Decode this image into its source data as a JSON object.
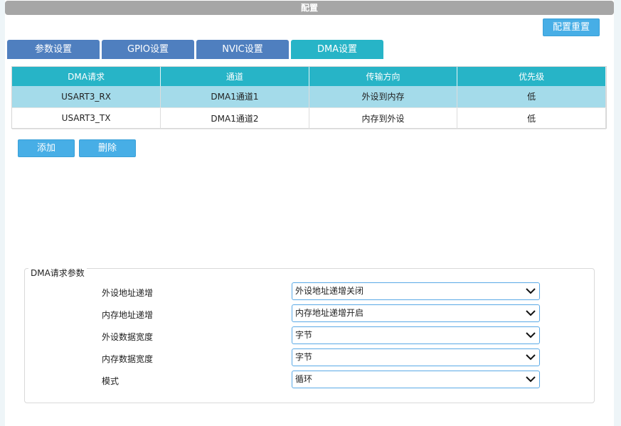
{
  "title": "配置",
  "reset_button": "配置重置",
  "tabs": [
    {
      "label": "参数设置"
    },
    {
      "label": "GPIO设置"
    },
    {
      "label": "NVIC设置"
    },
    {
      "label": "DMA设置"
    }
  ],
  "table": {
    "headers": [
      "DMA请求",
      "通道",
      "传输方向",
      "优先级"
    ],
    "rows": [
      [
        "USART3_RX",
        "DMA1通道1",
        "外设到内存",
        "低"
      ],
      [
        "USART3_TX",
        "DMA1通道2",
        "内存到外设",
        "低"
      ]
    ]
  },
  "actions": {
    "add": "添加",
    "delete": "删除"
  },
  "params": {
    "legend": "DMA请求参数",
    "fields": [
      {
        "label": "外设地址递增",
        "value": "外设地址递增关闭"
      },
      {
        "label": "内存地址递增",
        "value": "内存地址递增开启"
      },
      {
        "label": "外设数据宽度",
        "value": "字节"
      },
      {
        "label": "内存数据宽度",
        "value": "字节"
      },
      {
        "label": "模式",
        "value": "循环"
      }
    ]
  },
  "colors": {
    "tab": "#4f7fbf",
    "tab_active": "#27b4c7",
    "header": "#27b4c7",
    "button": "#47aee6",
    "selected_row": "#a4dbea"
  }
}
